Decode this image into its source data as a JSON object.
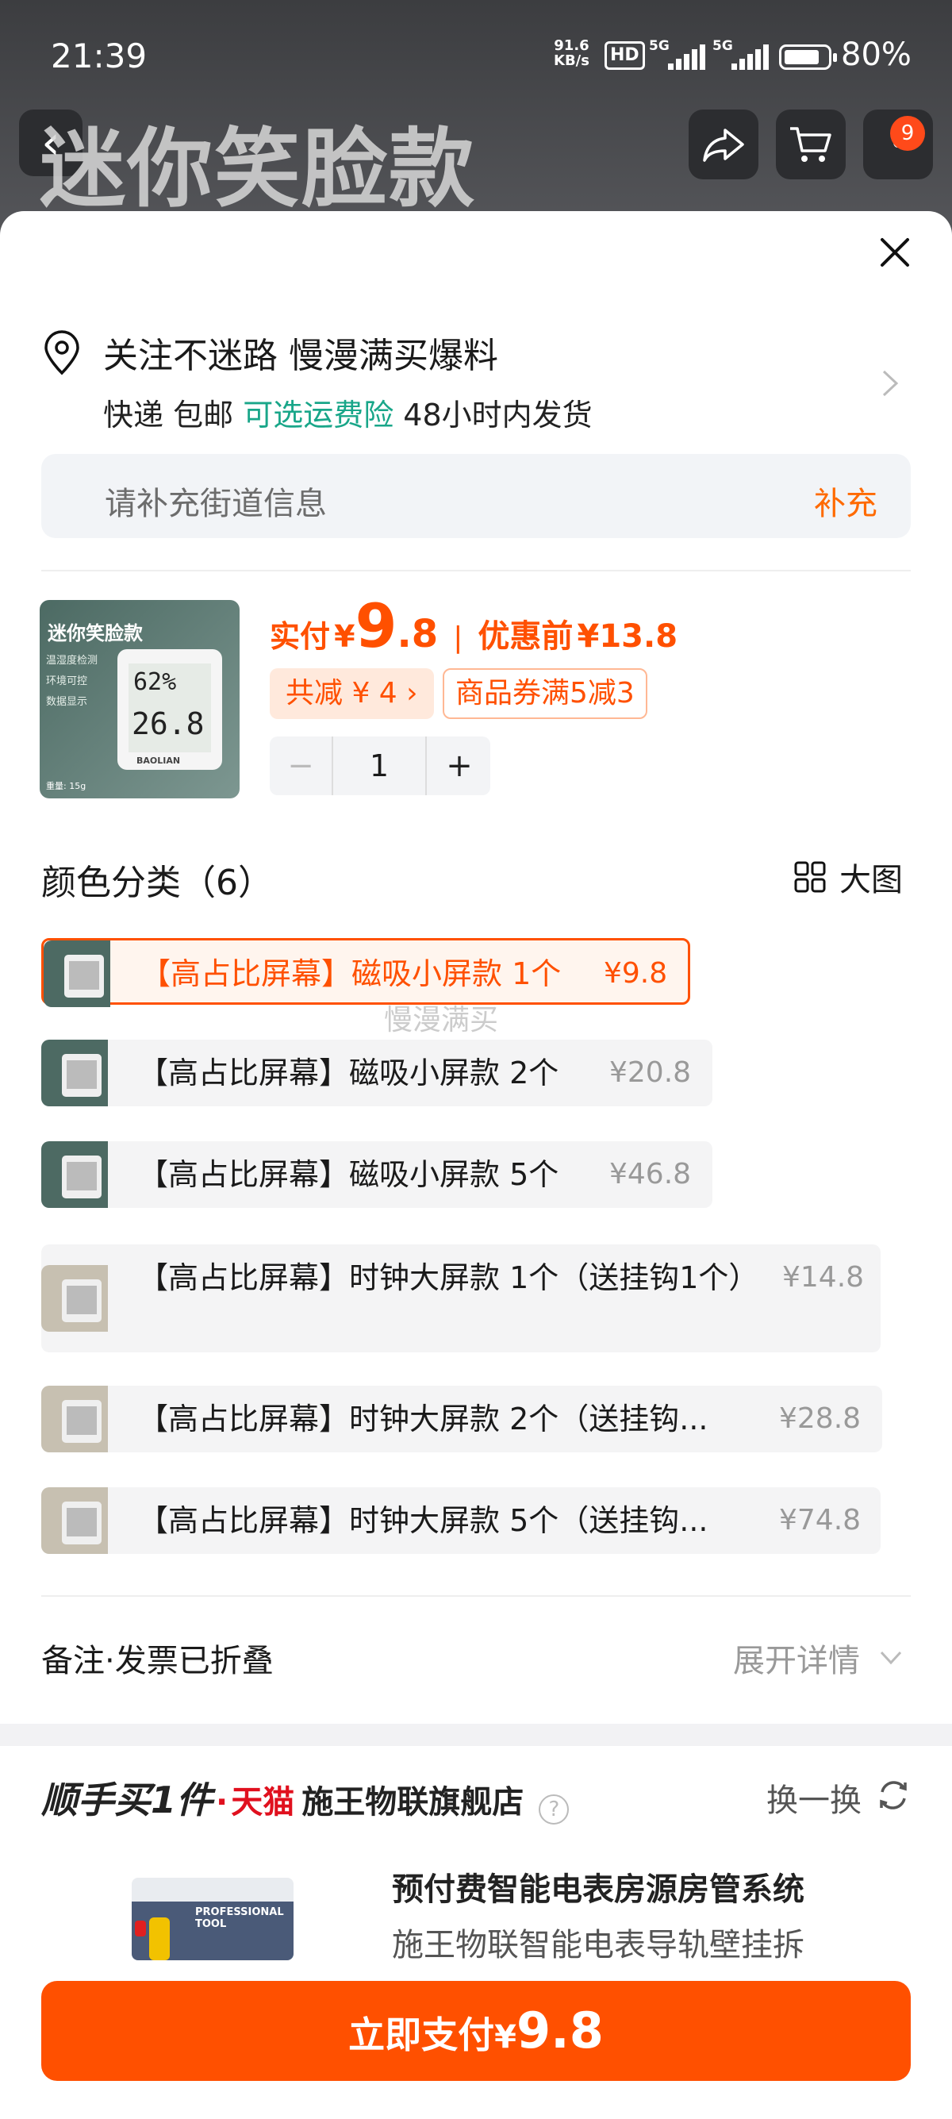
{
  "status_bar": {
    "time": "21:39",
    "net_speed_value": "91.6",
    "net_speed_unit": "KB/s",
    "hd": "HD",
    "sig1": "5G",
    "sig2": "5G",
    "battery_pct": 0.8,
    "battery_text": "80%"
  },
  "header": {
    "banner_text": "迷你笑脸款",
    "cart_badge": "9"
  },
  "address": {
    "line1": "关注不迷路 慢漫满买爆料",
    "delivery": "快递 包邮",
    "insurance": "可选运费险",
    "ship_time": "48小时内发货"
  },
  "street": {
    "placeholder": "请补充街道信息",
    "action": "补充"
  },
  "product": {
    "image_title": "迷你笑脸款",
    "image_bullets": [
      "温湿度检测",
      "环境可控",
      "数据显示"
    ],
    "device_hum": "62%",
    "device_temp": "26.8",
    "device_brand": "BAOLIAN",
    "image_weight": "重量: 15g",
    "price_prefix": "实付",
    "currency": "¥",
    "price_int": "9",
    "price_dec": ".8",
    "price_separator": "|",
    "orig_label": "优惠前",
    "orig_price": "¥13.8",
    "discount_tag": "共减 ¥ 4 ›",
    "coupon_tag": "商品券满5减3",
    "quantity": "1",
    "minus": "−",
    "plus": "+"
  },
  "variants": {
    "title": "颜色分类（6）",
    "big_view": "大图",
    "watermark": "慢漫满买",
    "items": [
      {
        "name": "【高占比屏幕】磁吸小屏款 1个",
        "price": "¥9.8"
      },
      {
        "name": "【高占比屏幕】磁吸小屏款 2个",
        "price": "¥20.8"
      },
      {
        "name": "【高占比屏幕】磁吸小屏款 5个",
        "price": "¥46.8"
      },
      {
        "name": "【高占比屏幕】时钟大屏款 1个（送挂钩1个）",
        "price": "¥14.8"
      },
      {
        "name": "【高占比屏幕】时钟大屏款 2个（送挂钩...",
        "price": "¥28.8"
      },
      {
        "name": "【高占比屏幕】时钟大屏款 5个（送挂钩...",
        "price": "¥74.8"
      }
    ]
  },
  "notes": {
    "label": "备注·发票已折叠",
    "expand": "展开详情"
  },
  "recommend": {
    "slogan": "顺手买1件",
    "dot": "·",
    "platform": "天猫",
    "shop": "施王物联旗舰店",
    "help": "?",
    "swap": "换一换",
    "image_text": "PROFESSIONAL TOOL",
    "title": "预付费智能电表房源房管系统",
    "subtitle": "施王物联智能电表导轨壁挂拆"
  },
  "pay_button": {
    "label": "立即支付",
    "currency": "¥",
    "amount": "9.8"
  },
  "colors": {
    "accent": "#ff5000",
    "green": "#19a689",
    "tmall": "#e0101e"
  }
}
